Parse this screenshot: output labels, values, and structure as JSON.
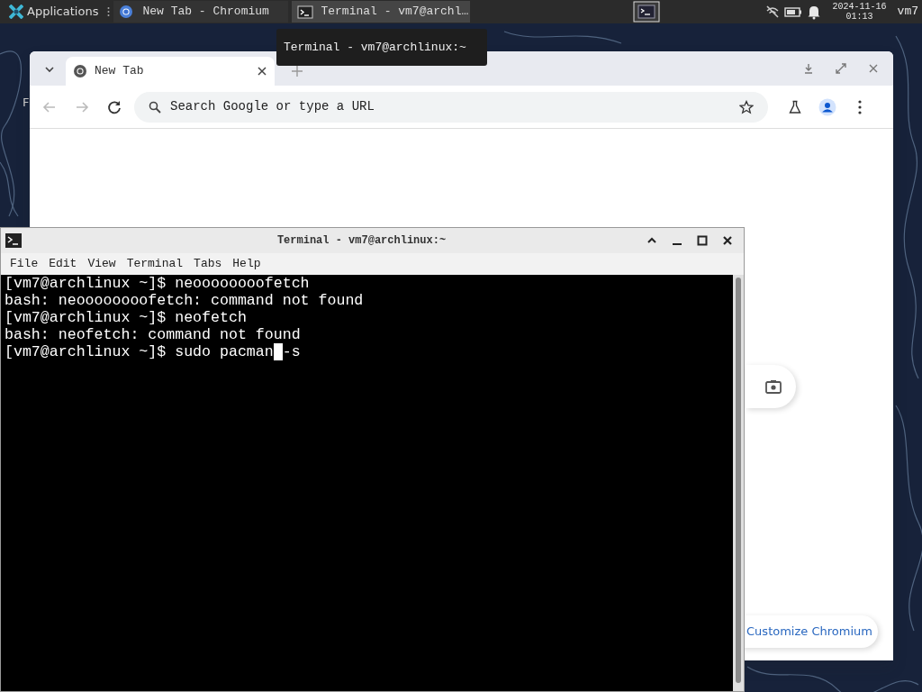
{
  "panel": {
    "menu_label": "Applications",
    "tasks": [
      {
        "kind": "browser",
        "label": "New Tab - Chromium",
        "selected": false
      },
      {
        "kind": "terminal",
        "label": "Terminal - vm7@archl…",
        "selected": true
      }
    ],
    "date": "2024-11-16",
    "time": "01:13",
    "user": "vm7"
  },
  "tooltip": "Terminal - vm7@archlinux:~",
  "desktop_fragment": "F",
  "browser": {
    "tabs": [
      {
        "label": "New Tab",
        "selected": true
      }
    ],
    "nav": [
      {
        "kind": "back",
        "disabled": true
      },
      {
        "kind": "forward",
        "disabled": true
      },
      {
        "kind": "reload",
        "disabled": false
      }
    ],
    "omnibox": {
      "placeholder": "Search Google or type a URL"
    },
    "customize_label": "Customize Chromium"
  },
  "terminal": {
    "title": "Terminal - vm7@archlinux:~",
    "menu": [
      "File",
      "Edit",
      "View",
      "Terminal",
      "Tabs",
      "Help"
    ],
    "lines": [
      {
        "kind": "prompt",
        "prompt": "[vm7@archlinux ~]$",
        "command": "neoooooooofetch"
      },
      {
        "kind": "output",
        "text": "bash: neoooooooofetch: command not found"
      },
      {
        "kind": "prompt",
        "prompt": "[vm7@archlinux ~]$",
        "command": "neofetch"
      },
      {
        "kind": "output",
        "text": "bash: neofetch: command not found"
      },
      {
        "kind": "prompt",
        "prompt": "[vm7@archlinux ~]$",
        "command": "sudo pacman",
        "after_cursor": "-s"
      }
    ]
  }
}
